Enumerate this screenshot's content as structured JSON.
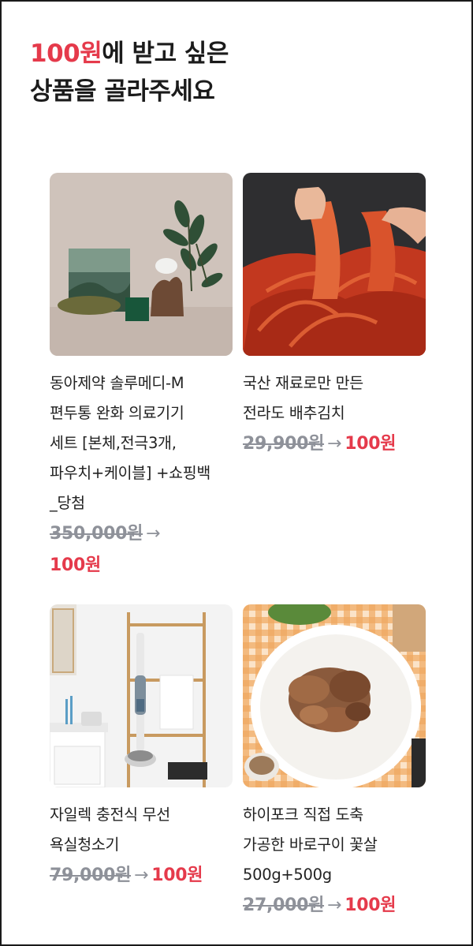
{
  "headline": {
    "accent": "100원",
    "line1_rest": "에 받고 싶은",
    "line2": "상품을 골라주세요"
  },
  "arrow": "→",
  "products": [
    {
      "name_lines": [
        "동아제약 솔루메디-M",
        "편두통 완화 의료기기",
        "세트 [본체,전극3개,",
        "파우치+케이블] +쇼핑백",
        "_당첨"
      ],
      "old_price": "350,000원",
      "new_price": "100원",
      "image_icon": "medical-device-icon"
    },
    {
      "name_lines": [
        "국산 재료로만 만든",
        "전라도 배추김치"
      ],
      "old_price": "29,900원",
      "new_price": "100원",
      "image_icon": "kimchi-icon"
    },
    {
      "name_lines": [
        "자일렉 충전식 무선",
        "욕실청소기"
      ],
      "old_price": "79,000원",
      "new_price": "100원",
      "image_icon": "cleaner-icon"
    },
    {
      "name_lines": [
        "하이포크 직접 도축",
        "가공한 바로구이 꽃살",
        "500g+500g"
      ],
      "old_price": "27,000원",
      "new_price": "100원",
      "image_icon": "pork-icon"
    }
  ],
  "colors": {
    "accent": "#e53a4b",
    "muted": "#8e9199",
    "text": "#222222"
  }
}
